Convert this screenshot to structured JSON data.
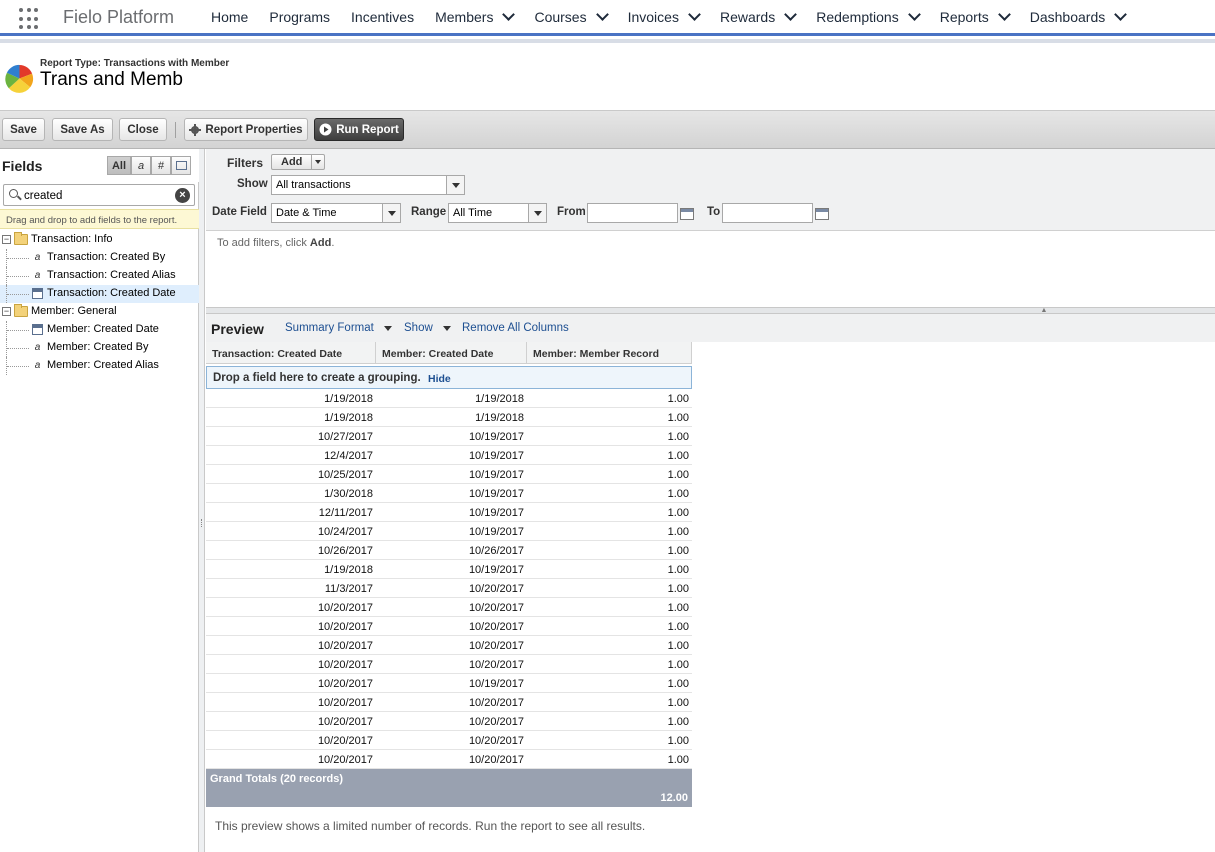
{
  "nav": {
    "app_name": "Fielo Platform",
    "items": [
      {
        "label": "Home",
        "has_menu": false
      },
      {
        "label": "Programs",
        "has_menu": false
      },
      {
        "label": "Incentives",
        "has_menu": false
      },
      {
        "label": "Members",
        "has_menu": true
      },
      {
        "label": "Courses",
        "has_menu": true
      },
      {
        "label": "Invoices",
        "has_menu": true
      },
      {
        "label": "Rewards",
        "has_menu": true
      },
      {
        "label": "Redemptions",
        "has_menu": true
      },
      {
        "label": "Reports",
        "has_menu": true
      },
      {
        "label": "Dashboards",
        "has_menu": true
      }
    ]
  },
  "report": {
    "type_label": "Report Type: Transactions with Member",
    "name": "Trans and Memb"
  },
  "toolbar": {
    "save": "Save",
    "save_as": "Save As",
    "close": "Close",
    "properties": "Report Properties",
    "run": "Run Report"
  },
  "fields": {
    "title": "Fields",
    "filter_all": "All",
    "filter_text": "a",
    "filter_number": "#",
    "search_value": "created",
    "hint": "Drag and drop to add fields to the report.",
    "groups": [
      {
        "label": "Transaction: Info",
        "items": [
          {
            "label": "Transaction: Created By",
            "icon": "text-field-icon"
          },
          {
            "label": "Transaction: Created Alias",
            "icon": "text-field-icon"
          },
          {
            "label": "Transaction: Created Date",
            "icon": "date-field-icon",
            "selected": true
          }
        ]
      },
      {
        "label": "Member: General",
        "items": [
          {
            "label": "Member: Created Date",
            "icon": "date-field-icon"
          },
          {
            "label": "Member: Created By",
            "icon": "text-field-icon"
          },
          {
            "label": "Member: Created Alias",
            "icon": "text-field-icon"
          }
        ]
      }
    ]
  },
  "filters": {
    "filters_label": "Filters",
    "add_label": "Add",
    "show_label": "Show",
    "show_value": "All transactions",
    "date_field_label": "Date Field",
    "date_field_value": "Date & Time",
    "range_label": "Range",
    "range_value": "All Time",
    "from_label": "From",
    "from_value": "",
    "to_label": "To",
    "to_value": "",
    "message_prefix": "To add filters, click ",
    "message_bold": "Add",
    "message_suffix": "."
  },
  "preview": {
    "title": "Preview",
    "format_link": "Summary Format",
    "show_link": "Show",
    "remove_link": "Remove All Columns",
    "columns": [
      "Transaction: Created Date",
      "Member: Created Date",
      "Member: Member Record"
    ],
    "group_drop_text": "Drop a field here to create a grouping.",
    "group_hide": "Hide",
    "rows": [
      [
        "1/19/2018",
        "1/19/2018",
        "1.00"
      ],
      [
        "1/19/2018",
        "1/19/2018",
        "1.00"
      ],
      [
        "10/27/2017",
        "10/19/2017",
        "1.00"
      ],
      [
        "12/4/2017",
        "10/19/2017",
        "1.00"
      ],
      [
        "10/25/2017",
        "10/19/2017",
        "1.00"
      ],
      [
        "1/30/2018",
        "10/19/2017",
        "1.00"
      ],
      [
        "12/11/2017",
        "10/19/2017",
        "1.00"
      ],
      [
        "10/24/2017",
        "10/19/2017",
        "1.00"
      ],
      [
        "10/26/2017",
        "10/26/2017",
        "1.00"
      ],
      [
        "1/19/2018",
        "10/19/2017",
        "1.00"
      ],
      [
        "11/3/2017",
        "10/20/2017",
        "1.00"
      ],
      [
        "10/20/2017",
        "10/20/2017",
        "1.00"
      ],
      [
        "10/20/2017",
        "10/20/2017",
        "1.00"
      ],
      [
        "10/20/2017",
        "10/20/2017",
        "1.00"
      ],
      [
        "10/20/2017",
        "10/20/2017",
        "1.00"
      ],
      [
        "10/20/2017",
        "10/19/2017",
        "1.00"
      ],
      [
        "10/20/2017",
        "10/20/2017",
        "1.00"
      ],
      [
        "10/20/2017",
        "10/20/2017",
        "1.00"
      ],
      [
        "10/20/2017",
        "10/20/2017",
        "1.00"
      ],
      [
        "10/20/2017",
        "10/20/2017",
        "1.00"
      ]
    ],
    "grand_total_label": "Grand Totals (20 records)",
    "grand_total_value": "12.00",
    "note": "This preview shows a limited number of records. Run the report to see all results."
  },
  "colors": {
    "nav_accent": "#4a73c4",
    "link": "#1d4f91",
    "grand_total_bg": "#99a1b0"
  }
}
